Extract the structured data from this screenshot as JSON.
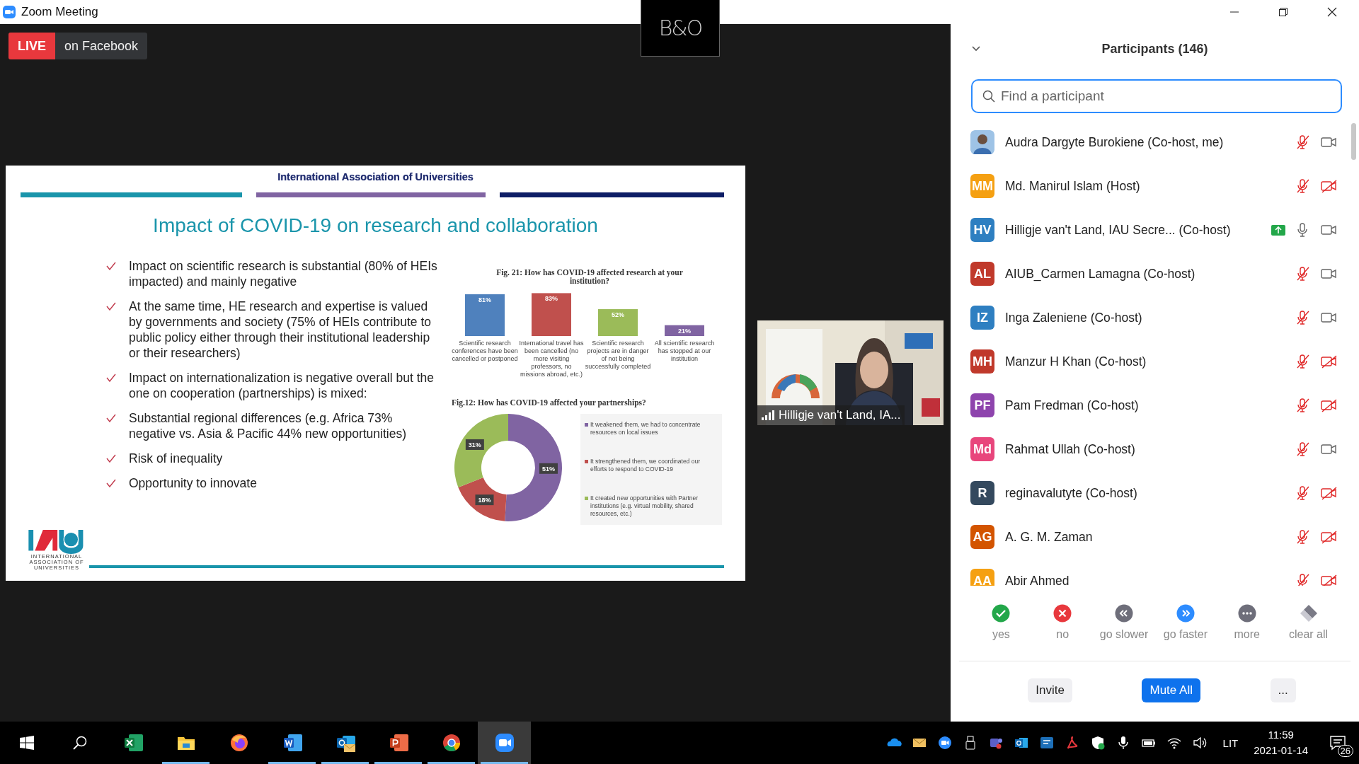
{
  "window": {
    "title": "Zoom Meeting"
  },
  "live_badge": {
    "label": "LIVE",
    "platform": "on Facebook"
  },
  "brand_logo": {
    "text": "B&O"
  },
  "slide": {
    "header": "International Association of Universities",
    "title": "Impact of COVID-19 on research and collaboration",
    "bullets": [
      "Impact on scientific research is substantial (80% of HEIs impacted) and mainly negative",
      "At the same time, HE research and expertise is valued by governments and society (75% of HEIs contribute to public policy either through their institutional leadership or their researchers)",
      "Impact on internationalization is negative overall but the one on cooperation (partnerships) is mixed:",
      "Substantial regional differences (e.g. Africa 73% negative vs. Asia & Pacific 44% new opportunities)",
      "Risk of inequality",
      "Opportunity to innovate"
    ],
    "bar_chart": {
      "chart_data": {
        "type": "bar",
        "title": "Fig. 21: How has COVID-19 affected research at your institution?",
        "categories": [
          "Scientific research conferences have been cancelled or postponed",
          "International travel has been cancelled (no more visiting professors, no missions abroad, etc.)",
          "Scientific research projects are in danger of not being successfully completed",
          "All scientific research has stopped at our institution"
        ],
        "values": [
          81,
          83,
          52,
          21
        ],
        "colors": [
          "#4f81bd",
          "#c0504d",
          "#9bbb59",
          "#8064a2"
        ],
        "value_labels": [
          "81%",
          "83%",
          "52%",
          "21%"
        ]
      }
    },
    "donut_chart": {
      "chart_data": {
        "type": "donut",
        "title": "Fig.12: How has COVID-19 affected your partnerships?",
        "categories": [
          "It weakened them, we had to concentrate resources on local issues",
          "It strengthened them, we coordinated our efforts to respond to COVID-19",
          "It created new opportunities with Partner institutions (e.g. virtual mobility, shared resources, etc.)"
        ],
        "values": [
          51,
          18,
          31
        ],
        "colors": [
          "#8064a2",
          "#c0504d",
          "#9bbb59"
        ],
        "value_labels": [
          "51%",
          "18%",
          "31%"
        ],
        "legend": "right"
      }
    },
    "logo_lines": [
      "INTERNATIONAL",
      "ASSOCIATION OF",
      "UNIVERSITIES"
    ]
  },
  "video_tile": {
    "kind": "picture",
    "name": "Hilligje van't Land, IA..."
  },
  "participants_panel": {
    "title": "Participants (146)",
    "search": {
      "placeholder": "Find a participant"
    },
    "participants": [
      {
        "name": "Audra Dargyte Burokiene (Co-host, me)",
        "sharing": false,
        "muted": true,
        "video_on": true
      },
      {
        "kind": "initials",
        "initials": "MM",
        "color": "#f5a012",
        "name": "Md. Manirul Islam (Host)",
        "sharing": false,
        "muted": true,
        "video_on": false
      },
      {
        "kind": "initials",
        "initials": "HV",
        "color": "#2e7fc1",
        "name": "Hilligje van't Land, IAU Secre...  (Co-host)",
        "sharing": true,
        "muted": false,
        "video_on": true
      },
      {
        "kind": "initials",
        "initials": "AL",
        "color": "#c0392b",
        "name": "AIUB_Carmen Lamagna (Co-host)",
        "sharing": false,
        "muted": true,
        "video_on": true
      },
      {
        "kind": "initials",
        "initials": "IZ",
        "color": "#2e7fc1",
        "name": "Inga Zaleniene (Co-host)",
        "sharing": false,
        "muted": true,
        "video_on": true
      },
      {
        "kind": "initials",
        "initials": "MH",
        "color": "#c0392b",
        "name": "Manzur H Khan (Co-host)",
        "sharing": false,
        "muted": true,
        "video_on": false
      },
      {
        "kind": "initials",
        "initials": "PF",
        "color": "#8e44ad",
        "name": "Pam Fredman (Co-host)",
        "sharing": false,
        "muted": true,
        "video_on": false
      },
      {
        "kind": "initials",
        "initials": "Md",
        "color": "#e8467c",
        "name": "Rahmat Ullah (Co-host)",
        "sharing": false,
        "muted": true,
        "video_on": true
      },
      {
        "kind": "initials",
        "initials": "R",
        "color": "#34495e",
        "name": "reginavalutyte (Co-host)",
        "sharing": false,
        "muted": true,
        "video_on": false
      },
      {
        "kind": "initials",
        "initials": "AG",
        "color": "#d35400",
        "name": "A. G. M. Zaman",
        "sharing": false,
        "muted": true,
        "video_on": false
      },
      {
        "kind": "initials",
        "initials": "AA",
        "color": "#f5a012",
        "name": "Abir Ahmed",
        "sharing": false,
        "muted": true,
        "video_on": false
      }
    ],
    "reactions": [
      {
        "kind": "yes",
        "label": "yes"
      },
      {
        "kind": "no",
        "label": "no"
      },
      {
        "kind": "slower",
        "label": "go slower"
      },
      {
        "kind": "faster",
        "label": "go faster"
      },
      {
        "kind": "more",
        "label": "more"
      },
      {
        "kind": "clear",
        "label": "clear all"
      }
    ],
    "buttons": [
      {
        "kind": "plain",
        "label": "Invite"
      },
      {
        "kind": "primary",
        "label": "Mute All"
      },
      {
        "kind": "plain",
        "label": "..."
      }
    ]
  },
  "taskbar": {
    "apps": [
      {
        "kind": "excel",
        "running": false,
        "active": false
      },
      {
        "kind": "explorer",
        "running": true,
        "active": false
      },
      {
        "kind": "firefox",
        "running": false,
        "active": false
      },
      {
        "kind": "word",
        "running": true,
        "active": false
      },
      {
        "kind": "outlook",
        "running": true,
        "active": false
      },
      {
        "kind": "powerpoint",
        "running": true,
        "active": false
      },
      {
        "kind": "chrome",
        "running": true,
        "active": false
      },
      {
        "kind": "zoom",
        "running": true,
        "active": true
      }
    ],
    "tray": [
      {
        "kind": "onedrive"
      },
      {
        "kind": "mail"
      },
      {
        "kind": "zoom"
      },
      {
        "kind": "usb"
      },
      {
        "kind": "teams"
      },
      {
        "kind": "outlook"
      },
      {
        "kind": "chat"
      },
      {
        "kind": "acrobat"
      },
      {
        "kind": "shield"
      },
      {
        "kind": "mic"
      },
      {
        "kind": "battery"
      },
      {
        "kind": "wifi"
      },
      {
        "kind": "speaker"
      }
    ],
    "language": "LIT",
    "time": "11:59",
    "date": "2021-01-14",
    "notifications": "26"
  }
}
